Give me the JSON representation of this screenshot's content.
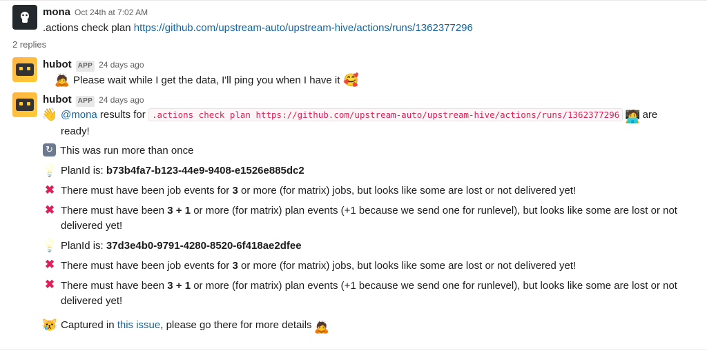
{
  "parent": {
    "sender": "mona",
    "timestamp": "Oct 24th at 7:02 AM",
    "command_prefix": ".actions check plan ",
    "url": "https://github.com/upstream-auto/upstream-hive/actions/runs/1362377296"
  },
  "replies_label": "2 replies",
  "reply1": {
    "sender": "hubot",
    "badge": "APP",
    "timestamp": "24 days ago",
    "text": "Please wait while I get the data, I'll ping you when I have it"
  },
  "reply2": {
    "sender": "hubot",
    "badge": "APP",
    "timestamp": "24 days ago",
    "mention": "@mona",
    "results_for": " results for ",
    "command": ".actions check plan https://github.com/upstream-auto/upstream-hive/actions/runs/1362377296",
    "ready": " are ready!",
    "multi_run": "This was run more than once",
    "plan1_label": "PlanId is: ",
    "plan1_id": "b73b4fa7-b123-44e9-9408-e1526e885dc2",
    "err1a_pre": "There must have been job events for ",
    "err1a_bold": "3",
    "err1a_post": " or more (for matrix) jobs, but looks like some are lost or not delivered yet!",
    "err1b_pre": "There must have been ",
    "err1b_bold": "3 + 1",
    "err1b_post": " or more (for matrix) plan events (+1 because we send one for runlevel), but looks like some are lost or not delivered yet!",
    "plan2_label": "PlanId is: ",
    "plan2_id": "37d3e4b0-9791-4280-8520-6f418ae2dfee",
    "err2a_pre": "There must have been job events for ",
    "err2a_bold": "3",
    "err2a_post": " or more (for matrix) jobs, but looks like some are lost or not delivered yet!",
    "err2b_pre": "There must have been ",
    "err2b_bold": "3 + 1",
    "err2b_post": " or more (for matrix) plan events (+1 because we send one for runlevel), but looks like some are lost or not delivered yet!",
    "captured_pre": "Captured in ",
    "captured_link": "this issue",
    "captured_post": ", please go there for more details"
  }
}
